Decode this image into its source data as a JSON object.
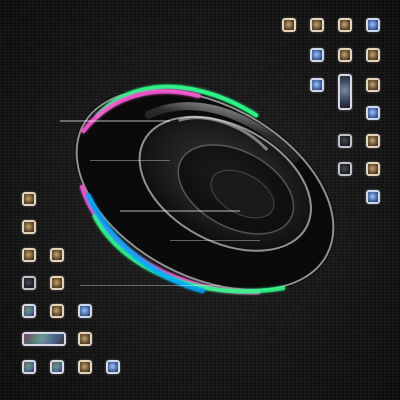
{
  "scene": {
    "colors": {
      "background": "#141414",
      "ring_pink": "#ff5ad6",
      "ring_green": "#2dff8a",
      "ring_blue": "#00a9ff",
      "ring_white": "#f2f2f2"
    },
    "icons": {
      "main_object": "glitch-torus-icon",
      "tile": "app-tile-icon"
    }
  }
}
